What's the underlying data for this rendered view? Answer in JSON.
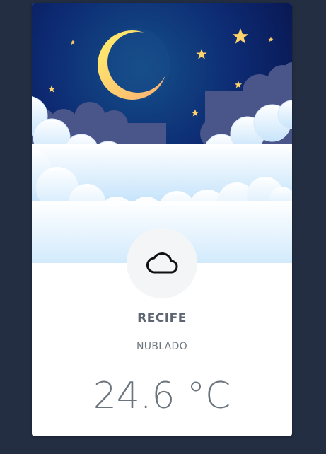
{
  "weather": {
    "city": "RECIFE",
    "condition": "NUBLADO",
    "temperature": "24.6 °C",
    "icon": "cloud-icon"
  },
  "colors": {
    "page_background": "#232e43",
    "card_background": "#ffffff",
    "text_muted": "#6c757d"
  }
}
